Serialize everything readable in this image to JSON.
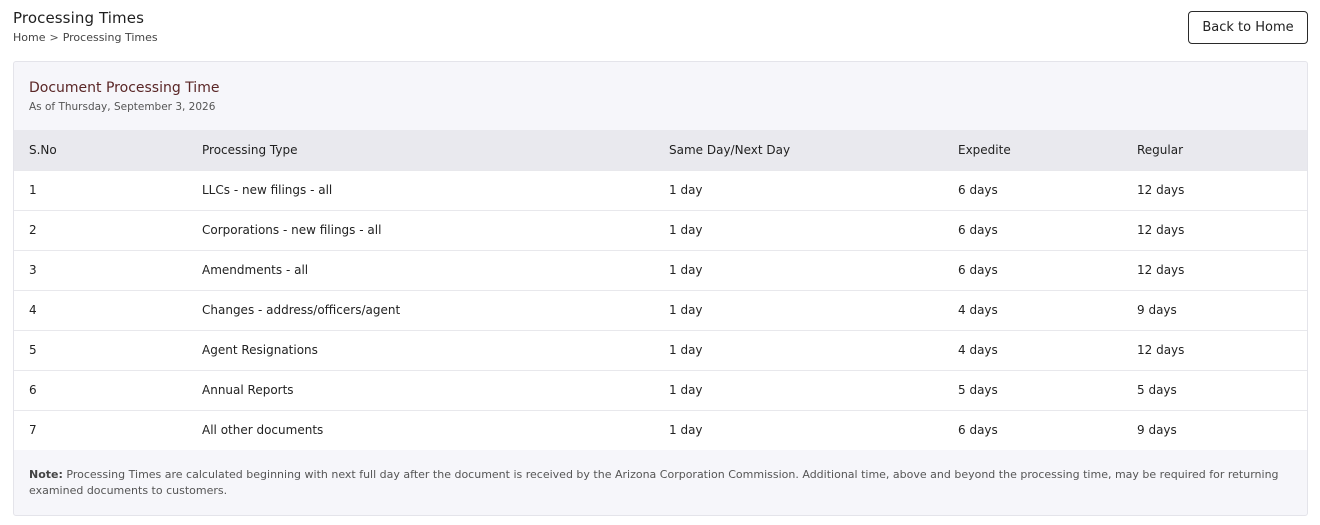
{
  "header": {
    "title": "Processing Times",
    "breadcrumb": {
      "home": "Home",
      "separator": ">",
      "current": "Processing Times"
    },
    "back_button": "Back to Home"
  },
  "card": {
    "title": "Document Processing Time",
    "subtitle": "As of Thursday, September 3, 2026"
  },
  "table": {
    "columns": [
      "S.No",
      "Processing Type",
      "Same Day/Next Day",
      "Expedite",
      "Regular"
    ],
    "rows": [
      [
        "1",
        "LLCs - new filings - all",
        "1 day",
        "6 days",
        "12 days"
      ],
      [
        "2",
        "Corporations - new filings - all",
        "1 day",
        "6 days",
        "12 days"
      ],
      [
        "3",
        "Amendments - all",
        "1 day",
        "6 days",
        "12 days"
      ],
      [
        "4",
        "Changes - address/officers/agent",
        "1 day",
        "4 days",
        "9 days"
      ],
      [
        "5",
        "Agent Resignations",
        "1 day",
        "4 days",
        "12 days"
      ],
      [
        "6",
        "Annual Reports",
        "1 day",
        "5 days",
        "5 days"
      ],
      [
        "7",
        "All other documents",
        "1 day",
        "6 days",
        "9 days"
      ]
    ]
  },
  "note": {
    "label": "Note:",
    "text": "Processing Times are calculated beginning with next full day after the document is received by the Arizona Corporation Commission. Additional time, above and beyond the processing time, may be required for returning examined documents to customers."
  }
}
